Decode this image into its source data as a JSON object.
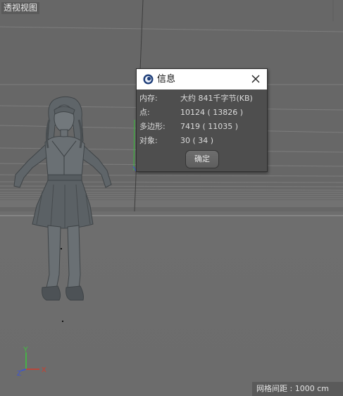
{
  "viewport": {
    "view_name": "透视视图",
    "grid_spacing": "网格间距 : 1000 cm",
    "axis_labels": {
      "x": "X",
      "y": "Y",
      "z": "Z"
    },
    "colors": {
      "x_axis": "#d23b2b",
      "y_axis": "#3cc63c",
      "z_axis": "#3a52d8"
    }
  },
  "info_dialog": {
    "title": "信息",
    "close_icon": "close-icon",
    "rows": [
      {
        "label": "内存:",
        "value": "大约 841千字节(KB)"
      },
      {
        "label": "点:",
        "value": "10124 ( 13826 )"
      },
      {
        "label": "多边形:",
        "value": "7419 ( 11035 )"
      },
      {
        "label": "对象:",
        "value": "30 ( 34 )"
      }
    ],
    "ok_label": "确定"
  }
}
